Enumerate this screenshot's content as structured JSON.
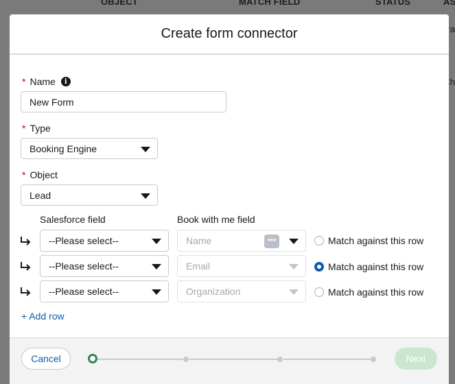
{
  "background": {
    "columns": [
      "OBJECT",
      "MATCH FIELD",
      "STATUS",
      "AS"
    ],
    "side_fragments": [
      "ra",
      "Ch"
    ]
  },
  "modal": {
    "title": "Create form connector",
    "name": {
      "label": "Name",
      "required_marker": "*",
      "value": "New Form",
      "info_icon": "i"
    },
    "type": {
      "label": "Type",
      "required_marker": "*",
      "value": "Booking Engine"
    },
    "object": {
      "label": "Object",
      "required_marker": "*",
      "value": "Lead"
    },
    "mapping": {
      "headers": {
        "salesforce": "Salesforce field",
        "bookwithme": "Book with me field"
      },
      "rows": [
        {
          "salesforce_value": "--Please select--",
          "bwm_placeholder": "Name",
          "match_label": "Match against this row",
          "match_selected": false
        },
        {
          "salesforce_value": "--Please select--",
          "bwm_placeholder": "Email",
          "match_label": "Match against this row",
          "match_selected": true
        },
        {
          "salesforce_value": "--Please select--",
          "bwm_placeholder": "Organization",
          "match_label": "Match against this row",
          "match_selected": false
        }
      ],
      "add_row_label": "+ Add row"
    },
    "footer": {
      "cancel_label": "Cancel",
      "next_label": "Next",
      "steps_total": 4,
      "current_step": 1
    }
  },
  "colors": {
    "accent": "#0b5cab",
    "required": "#ba0517",
    "step_active": "#2e844a",
    "next_disabled": "#c9e6cf"
  }
}
